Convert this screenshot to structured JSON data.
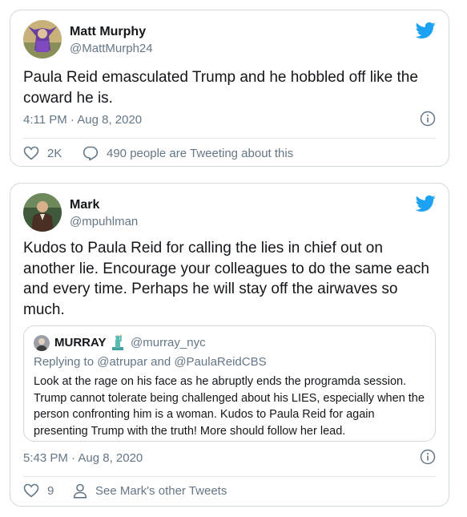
{
  "colors": {
    "twitter_blue": "#1DA1F2",
    "secondary_text": "#657786",
    "border": "#CFD9DE"
  },
  "tweets": [
    {
      "author_name": "Matt Murphy",
      "author_handle": "@MattMurph24",
      "text": "Paula Reid emasculated Trump and he hobbled off like the coward he is.",
      "timestamp": "4:11 PM · Aug 8, 2020",
      "likes": "2K",
      "conversation": "490 people are Tweeting about this",
      "icons": [
        "twitter-bird-icon",
        "info-icon",
        "heart-icon",
        "speech-bubble-icon"
      ]
    },
    {
      "author_name": "Mark",
      "author_handle": "@mpuhlman",
      "text": "Kudos to Paula Reid for calling the lies in chief out on another lie. Encourage your colleagues to do the same each and every time. Perhaps he will stay off the airwaves so much.",
      "timestamp": "5:43 PM · Aug 8, 2020",
      "likes": "9",
      "profile_link": "See Mark's other Tweets",
      "icons": [
        "twitter-bird-icon",
        "info-icon",
        "heart-icon",
        "person-icon"
      ],
      "quoted": {
        "author_name": "MURRAY",
        "author_handle": "@murray_nyc",
        "replying_to": "Replying to @atrupar and @PaulaReidCBS",
        "text": "Look at the rage on his face as he abruptly ends the programda session. Trump cannot tolerate being challenged about his LIES, especially when the person confronting him is a  woman. Kudos to Paula Reid for again presenting Trump with the truth! More should follow her lead.",
        "icons": [
          "statue-of-liberty-icon"
        ]
      }
    }
  ]
}
